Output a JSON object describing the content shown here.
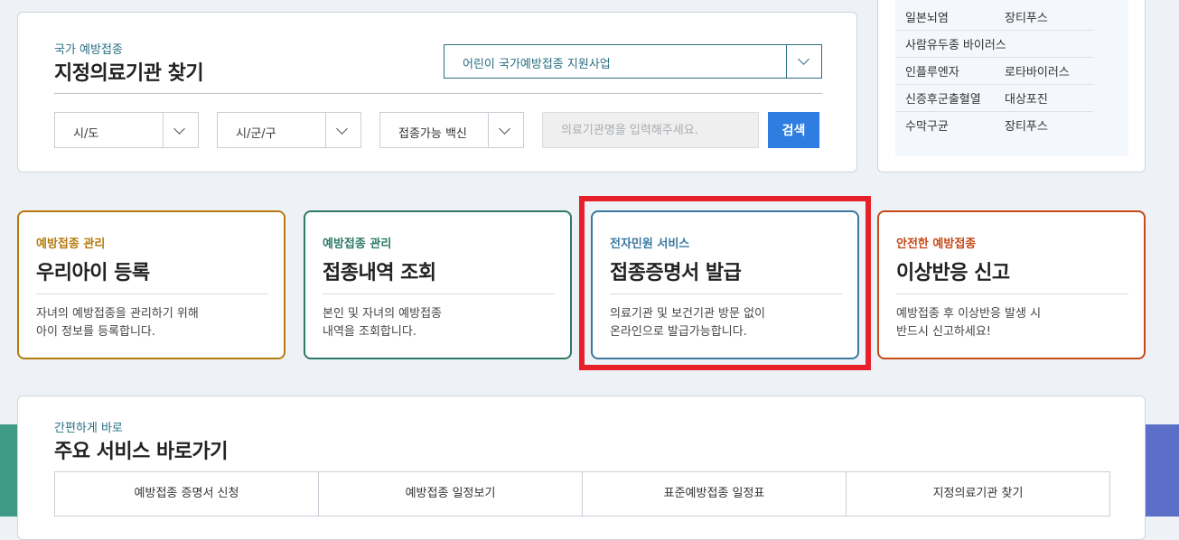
{
  "search": {
    "subtitle": "국가 예방접종",
    "title": "지정의료기관 찾기",
    "program_select": "어린이 국가예방접종 지원사업",
    "sido": "시/도",
    "sigungu": "시/군/구",
    "vaccine": "접종가능 백신",
    "name_placeholder": "의료기관명을 입력해주세요.",
    "search_button": "검색"
  },
  "diseases": [
    [
      "일본뇌염",
      "장티푸스"
    ],
    [
      "사람유두종 바이러스",
      ""
    ],
    [
      "인플루엔자",
      "로타바이러스"
    ],
    [
      "신증후군출혈열",
      "대상포진"
    ],
    [
      "수막구균",
      "장티푸스"
    ]
  ],
  "cards": [
    {
      "category": "예방접종 관리",
      "title": "우리아이 등록",
      "desc1": "자녀의 예방접종을 관리하기 위해",
      "desc2": "아이 정보를 등록합니다.",
      "color": "#b57a0e"
    },
    {
      "category": "예방접종 관리",
      "title": "접종내역 조회",
      "desc1": "본인 및 자녀의 예방접종",
      "desc2": "내역을 조회합니다.",
      "color": "#2d7a67"
    },
    {
      "category": "전자민원 서비스",
      "title": "접종증명서 발급",
      "desc1": "의료기관 및 보건기관 방문 없이",
      "desc2": "온라인으로 발급가능합니다.",
      "color": "#3a78a1"
    },
    {
      "category": "안전한 예방접종",
      "title": "이상반응 신고",
      "desc1": "예방접종 후 이상반응 발생 시",
      "desc2": "반드시 신고하세요!",
      "color": "#c44a16"
    }
  ],
  "quick": {
    "subtitle": "간편하게 바로",
    "title": "주요 서비스 바로가기",
    "links": [
      "예방접종 증명서 신청",
      "예방접종 일정보기",
      "표준예방접종 일정표",
      "지정의료기관 찾기"
    ]
  }
}
